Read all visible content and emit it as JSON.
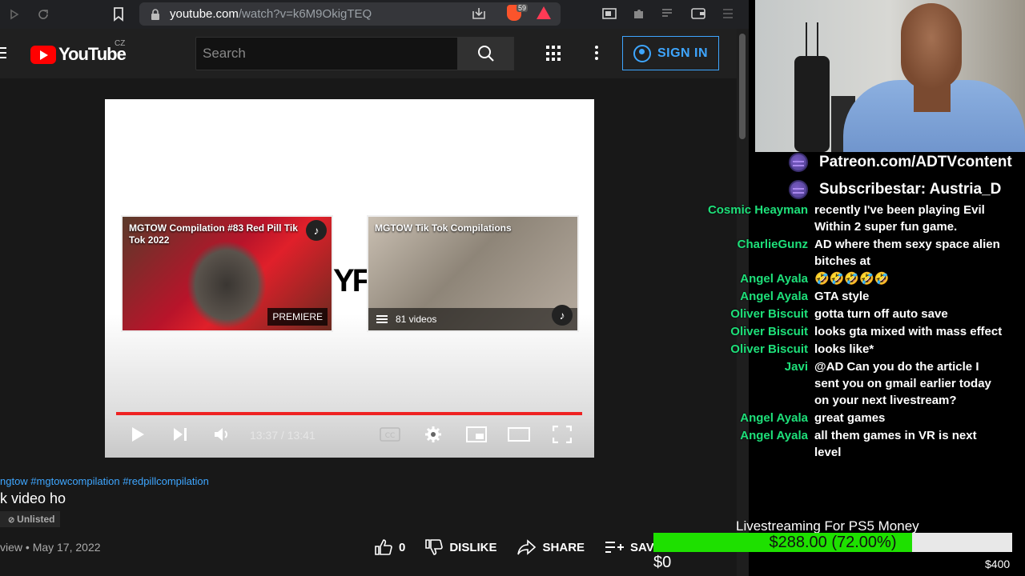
{
  "browser": {
    "url_host": "youtube.com",
    "url_path": "/watch?v=k6M9OkigTEQ",
    "brave_count": "59"
  },
  "youtube": {
    "logo_text": "YouTube",
    "country": "CZ",
    "search_placeholder": "Search",
    "sign_in": "SIGN IN"
  },
  "player": {
    "endcards": [
      {
        "title": "MGTOW Compilation #83 Red Pill Tik Tok 2022",
        "badge": "PREMIERE"
      },
      {
        "title": "MGTOW Tik Tok Compilations",
        "count": "81 videos"
      }
    ],
    "mid_text": "YF",
    "time": "13:37 / 13:41",
    "progress": 0.9951
  },
  "video_info": {
    "tags": "ngtow #mgtowcompilation #redpillcompilation",
    "title": "k video ho",
    "visibility": "Unlisted",
    "views_date": "view • May 17, 2022",
    "likes": "0",
    "dislike": "DISLIKE",
    "share": "SHARE",
    "save": "SAV"
  },
  "overlay": {
    "promos": [
      "Patreon.com/ADTVcontent",
      "Subscribestar: Austria_D"
    ],
    "chat": [
      {
        "user": "Cosmic Heayman",
        "text": "recently I've been playing Evil Within 2 super fun game."
      },
      {
        "user": "CharlieGunz",
        "text": "AD where them sexy space alien bitches at"
      },
      {
        "user": "Angel Ayala",
        "text": "🤣🤣🤣🤣🤣"
      },
      {
        "user": "Angel Ayala",
        "text": "GTA style"
      },
      {
        "user": "Oliver Biscuit",
        "text": "gotta turn off auto save"
      },
      {
        "user": "Oliver Biscuit",
        "text": "looks gta mixed with mass effect"
      },
      {
        "user": "Oliver Biscuit",
        "text": "looks like*"
      },
      {
        "user": "Javi",
        "text": "@AD Can you do the article I sent you on gmail earlier today on your next livestream?"
      },
      {
        "user": "Angel Ayala",
        "text": "great games"
      },
      {
        "user": "Angel Ayala",
        "text": "all them games in VR is next level"
      }
    ],
    "goal": {
      "title": "Livestreaming For PS5 Money",
      "value_text": "$288.00 (72.00%)",
      "fraction": 0.72,
      "min": "$0",
      "max": "$400"
    }
  },
  "colors": {
    "chat_user": "#1ee07a",
    "accent_blue": "#3ea6ff",
    "yt_red": "#ff0000",
    "goal_fill": "#1ee000"
  }
}
